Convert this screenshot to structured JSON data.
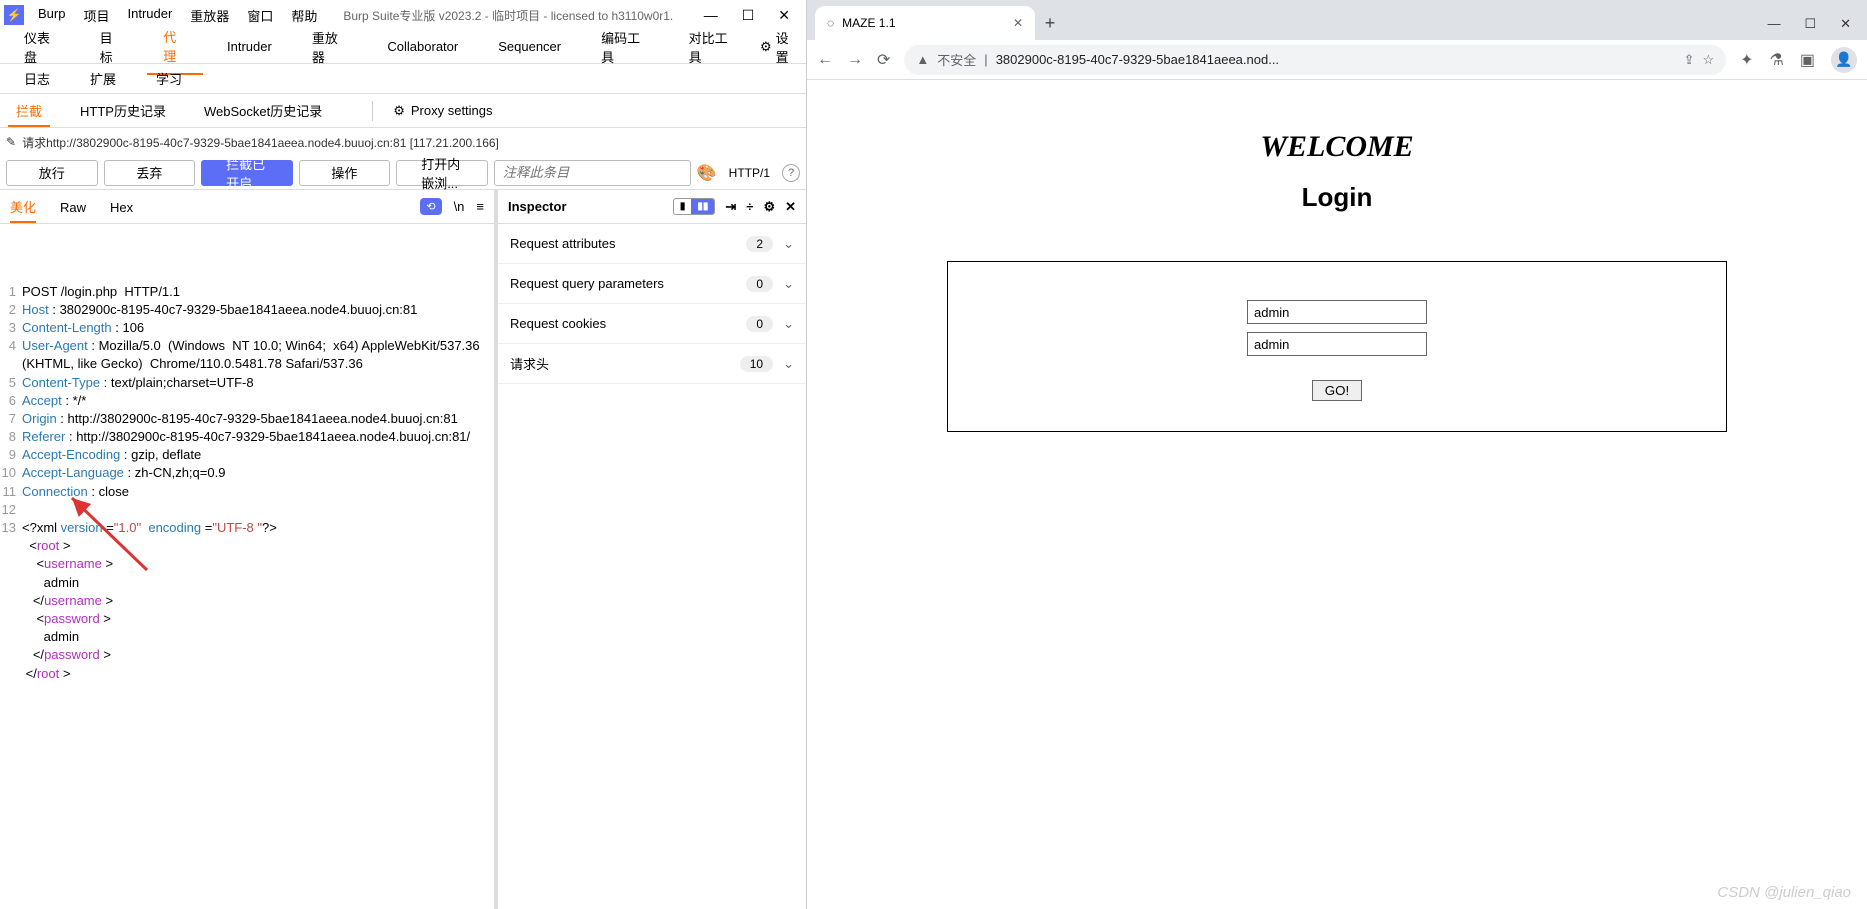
{
  "burp": {
    "menu": [
      "Burp",
      "项目",
      "Intruder",
      "重放器",
      "窗口",
      "帮助"
    ],
    "title": "Burp Suite专业版  v2023.2 - 临时项目 - licensed to h3110w0r1.",
    "tabs_row1": [
      "仪表盘",
      "目标",
      "代理",
      "Intruder",
      "重放器",
      "Collaborator",
      "Sequencer",
      "编码工具",
      "对比工具"
    ],
    "tabs_row1_active": 2,
    "tabs_row1_extra": "设置",
    "tabs_row2": [
      "日志",
      "扩展",
      "学习"
    ],
    "subtabs": [
      "拦截",
      "HTTP历史记录",
      "WebSocket历史记录"
    ],
    "subtabs_active": 0,
    "proxy_settings": "Proxy settings",
    "request_line": "请求http://3802900c-8195-40c7-9329-5bae1841aeea.node4.buuoj.cn:81  [117.21.200.166]",
    "actions": {
      "forward": "放行",
      "drop": "丢弃",
      "intercept": "拦截已开启",
      "action": "操作",
      "open": "打开内嵌浏..."
    },
    "comment_placeholder": "注释此条目",
    "http_label": "HTTP/1",
    "editor_tabs": [
      "美化",
      "Raw",
      "Hex"
    ],
    "editor_active": 0,
    "code": [
      {
        "n": "1",
        "parts": [
          {
            "t": "POST /login.php  HTTP/1.1",
            "c": ""
          }
        ]
      },
      {
        "n": "2",
        "parts": [
          {
            "t": "Host",
            "c": "hk"
          },
          {
            "t": " : 3802900c-8195-40c7-9329-5bae1841aeea.node4.buuoj.cn:81",
            "c": ""
          }
        ]
      },
      {
        "n": "3",
        "parts": [
          {
            "t": "Content-Length",
            "c": "hk"
          },
          {
            "t": " : 106",
            "c": ""
          }
        ]
      },
      {
        "n": "4",
        "parts": [
          {
            "t": "User-Agent",
            "c": "hk"
          },
          {
            "t": " : Mozilla/5.0  (Windows  NT 10.0; Win64;  x64) AppleWebKit/537.36  (KHTML, like Gecko)  Chrome/110.0.5481.78 Safari/537.36",
            "c": ""
          }
        ]
      },
      {
        "n": "5",
        "parts": [
          {
            "t": "Content-Type",
            "c": "hk"
          },
          {
            "t": " : text/plain;charset=UTF-8",
            "c": ""
          }
        ]
      },
      {
        "n": "6",
        "parts": [
          {
            "t": "Accept",
            "c": "hk"
          },
          {
            "t": " : */*",
            "c": ""
          }
        ]
      },
      {
        "n": "7",
        "parts": [
          {
            "t": "Origin",
            "c": "hk"
          },
          {
            "t": " : http://3802900c-8195-40c7-9329-5bae1841aeea.node4.buuoj.cn:81",
            "c": ""
          }
        ]
      },
      {
        "n": "8",
        "parts": [
          {
            "t": "Referer",
            "c": "hk"
          },
          {
            "t": " : http://3802900c-8195-40c7-9329-5bae1841aeea.node4.buuoj.cn:81/",
            "c": ""
          }
        ]
      },
      {
        "n": "9",
        "parts": [
          {
            "t": "Accept-Encoding",
            "c": "hk"
          },
          {
            "t": " : gzip, deflate",
            "c": ""
          }
        ]
      },
      {
        "n": "10",
        "parts": [
          {
            "t": "Accept-Language",
            "c": "hk"
          },
          {
            "t": " : zh-CN,zh;q=0.9",
            "c": ""
          }
        ]
      },
      {
        "n": "11",
        "parts": [
          {
            "t": "Connection",
            "c": "hk"
          },
          {
            "t": " : close",
            "c": ""
          }
        ]
      },
      {
        "n": "12",
        "parts": [
          {
            "t": "",
            "c": ""
          }
        ]
      },
      {
        "n": "13",
        "parts": [
          {
            "t": "<?xml ",
            "c": ""
          },
          {
            "t": "version",
            "c": "xa"
          },
          {
            "t": " =",
            "c": ""
          },
          {
            "t": "\"1.0\"",
            "c": "xs"
          },
          {
            "t": "  ",
            "c": ""
          },
          {
            "t": "encoding",
            "c": "xa"
          },
          {
            "t": " =",
            "c": ""
          },
          {
            "t": "\"UTF-8 \"",
            "c": "xs"
          },
          {
            "t": "?>",
            "c": ""
          }
        ]
      },
      {
        "n": "",
        "parts": [
          {
            "t": "  <",
            "c": ""
          },
          {
            "t": "root",
            "c": "xt"
          },
          {
            "t": " >",
            "c": ""
          }
        ]
      },
      {
        "n": "",
        "parts": [
          {
            "t": "    <",
            "c": ""
          },
          {
            "t": "username",
            "c": "xt"
          },
          {
            "t": " >",
            "c": ""
          }
        ]
      },
      {
        "n": "",
        "parts": [
          {
            "t": "      admin",
            "c": ""
          }
        ]
      },
      {
        "n": "",
        "parts": [
          {
            "t": "   </",
            "c": ""
          },
          {
            "t": "username",
            "c": "xt"
          },
          {
            "t": " >",
            "c": ""
          }
        ]
      },
      {
        "n": "",
        "parts": [
          {
            "t": "    <",
            "c": ""
          },
          {
            "t": "password",
            "c": "xt"
          },
          {
            "t": " >",
            "c": ""
          }
        ]
      },
      {
        "n": "",
        "parts": [
          {
            "t": "      admin",
            "c": ""
          }
        ]
      },
      {
        "n": "",
        "parts": [
          {
            "t": "   </",
            "c": ""
          },
          {
            "t": "password",
            "c": "xt"
          },
          {
            "t": " >",
            "c": ""
          }
        ]
      },
      {
        "n": "",
        "parts": [
          {
            "t": "",
            "c": ""
          }
        ]
      },
      {
        "n": "",
        "parts": [
          {
            "t": " </",
            "c": ""
          },
          {
            "t": "root",
            "c": "xt"
          },
          {
            "t": " >",
            "c": ""
          }
        ]
      }
    ],
    "inspector": {
      "title": "Inspector",
      "items": [
        {
          "label": "Request attributes",
          "count": "2"
        },
        {
          "label": "Request query parameters",
          "count": "0"
        },
        {
          "label": "Request cookies",
          "count": "0"
        },
        {
          "label": "请求头",
          "count": "10"
        }
      ]
    }
  },
  "chrome": {
    "tab_title": "MAZE 1.1",
    "url_warn": "不安全",
    "url": "3802900c-8195-40c7-9329-5bae1841aeea.nod...",
    "page": {
      "welcome": "WELCOME",
      "login": "Login",
      "user_value": "admin",
      "pass_value": "admin",
      "go": "GO!"
    },
    "watermark": "CSDN @julien_qiao"
  }
}
